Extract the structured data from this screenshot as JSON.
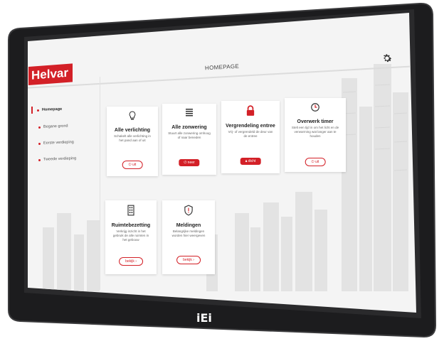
{
  "header": {
    "logo_text": "Helvar",
    "page_title": "HOMEPAGE",
    "settings_icon": "gear-icon"
  },
  "sidebar": {
    "items": [
      {
        "label": "Homepage",
        "active": true
      },
      {
        "label": "Begane grond",
        "active": false
      },
      {
        "label": "Eerste verdieping",
        "active": false
      },
      {
        "label": "Tweede verdieping",
        "active": false
      }
    ]
  },
  "cards": [
    {
      "title": "Alle verlichting",
      "desc": "Schakelt alle verlichting in het pand aan of uit",
      "button": "uit",
      "icon": "lightbulb-icon"
    },
    {
      "title": "Alle zonwering",
      "desc": "Stuurt alle zonwering omhoog of naar beneden",
      "button": "neer",
      "icon": "blinds-icon"
    },
    {
      "title": "Vergrendeling entree",
      "desc": "Vrij- of vergrendeld de deur van de entree",
      "button": "dicht",
      "icon": "lock-icon"
    },
    {
      "title": "Overwerk timer",
      "desc": "Stelt een tijd in om het licht en de verwarming wat langer aan te houden",
      "button": "uit",
      "icon": "clock-icon"
    },
    {
      "title": "Ruimtebezetting",
      "desc": "Verkrijg inzicht in het gebruik de alle ruimten in het gebouw",
      "button": "bekijk",
      "icon": "building-icon"
    },
    {
      "title": "Meldingen",
      "desc": "Belangrijke meldingen worden hier weergeven",
      "button": "bekijk",
      "icon": "shield-alert-icon"
    }
  ],
  "device": {
    "brand": "iEi"
  },
  "colors": {
    "accent": "#d32027",
    "bezel": "#1c1c1e",
    "screen_bg": "#f4f4f4"
  }
}
